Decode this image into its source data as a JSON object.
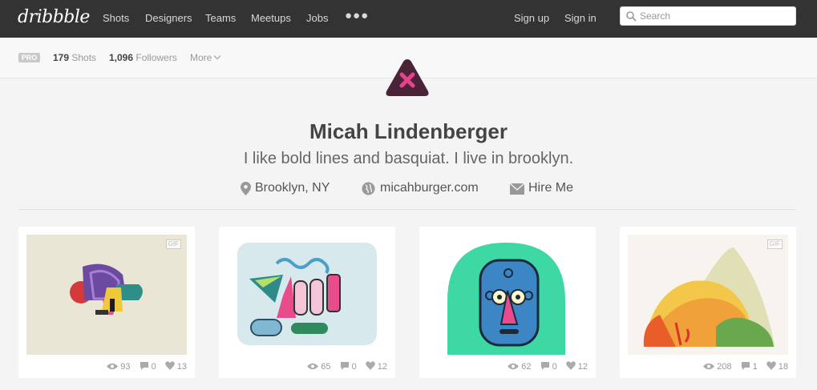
{
  "nav": {
    "logo": "dribbble",
    "links": [
      "Shots",
      "Designers",
      "Teams",
      "Meetups",
      "Jobs"
    ],
    "sign_up": "Sign up",
    "sign_in": "Sign in",
    "search_placeholder": "Search"
  },
  "subbar": {
    "badge": "PRO",
    "shots_count": "179",
    "shots_label": "Shots",
    "followers_count": "1,096",
    "followers_label": "Followers",
    "more": "More"
  },
  "profile": {
    "name": "Micah Lindenberger",
    "bio": "I like bold lines and basquiat. I live in brooklyn.",
    "location": "Brooklyn, NY",
    "website": "micahburger.com",
    "hire": "Hire Me"
  },
  "shots": [
    {
      "gif": "GIF",
      "views": "93",
      "comments": "0",
      "likes": "13"
    },
    {
      "gif": "",
      "views": "65",
      "comments": "0",
      "likes": "12"
    },
    {
      "gif": "",
      "views": "62",
      "comments": "0",
      "likes": "12"
    },
    {
      "gif": "GIF",
      "views": "208",
      "comments": "1",
      "likes": "18"
    }
  ],
  "colors": {
    "nav_bg": "#333333",
    "avatar_bg": "#4a2339",
    "avatar_accent": "#e7428c"
  }
}
